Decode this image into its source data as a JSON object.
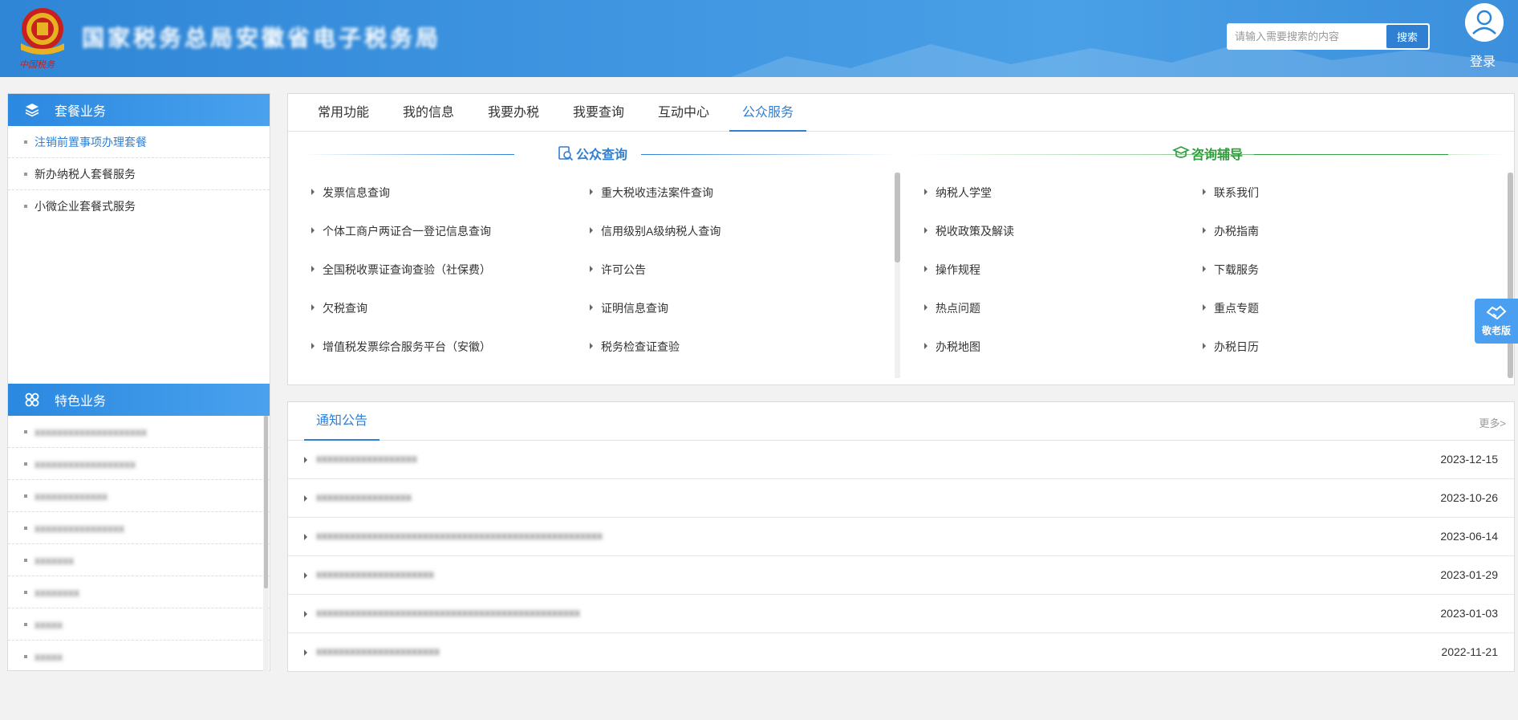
{
  "header": {
    "site_title": "国家税务总局安徽省电子税务局",
    "search_placeholder": "请输入需要搜索的内容",
    "search_button": "搜索",
    "login_label": "登录"
  },
  "sidebar": {
    "package_title": "套餐业务",
    "package_items": [
      {
        "label": "注销前置事项办理套餐",
        "active": true
      },
      {
        "label": "新办纳税人套餐服务",
        "active": false
      },
      {
        "label": "小微企业套餐式服务",
        "active": false
      }
    ],
    "special_title": "特色业务",
    "special_items": [
      {
        "label": "xxxxxxxxxxxxxxxxxxxx"
      },
      {
        "label": "xxxxxxxxxxxxxxxxxx"
      },
      {
        "label": "xxxxxxxxxxxxx"
      },
      {
        "label": "xxxxxxxxxxxxxxxx"
      },
      {
        "label": "xxxxxxx"
      },
      {
        "label": "xxxxxxxx"
      },
      {
        "label": "xxxxx"
      },
      {
        "label": "xxxxx"
      }
    ]
  },
  "tabs": [
    {
      "label": "常用功能",
      "active": false
    },
    {
      "label": "我的信息",
      "active": false
    },
    {
      "label": "我要办税",
      "active": false
    },
    {
      "label": "我要查询",
      "active": false
    },
    {
      "label": "互动中心",
      "active": false
    },
    {
      "label": "公众服务",
      "active": true
    }
  ],
  "public_query": {
    "title": "公众查询",
    "col1": [
      "发票信息查询",
      "个体工商户两证合一登记信息查询",
      "全国税收票证查询查验（社保费）",
      "欠税查询",
      "增值税发票综合服务平台（安徽）"
    ],
    "col2": [
      "重大税收违法案件查询",
      "信用级别A级纳税人查询",
      "许可公告",
      "证明信息查询",
      "税务检查证查验"
    ]
  },
  "consult": {
    "title": "咨询辅导",
    "col1": [
      "纳税人学堂",
      "税收政策及解读",
      "操作规程",
      "热点问题",
      "办税地图"
    ],
    "col2": [
      "联系我们",
      "办税指南",
      "下载服务",
      "重点专题",
      "办税日历"
    ]
  },
  "elder_mode": {
    "label": "敬老版"
  },
  "notices": {
    "tab_label": "通知公告",
    "more_label": "更多>",
    "items": [
      {
        "title": "xxxxxxxxxxxxxxxxxx",
        "date": "2023-12-15"
      },
      {
        "title": "xxxxxxxxxxxxxxxxx",
        "date": "2023-10-26"
      },
      {
        "title": "xxxxxxxxxxxxxxxxxxxxxxxxxxxxxxxxxxxxxxxxxxxxxxxxxxx",
        "date": "2023-06-14"
      },
      {
        "title": "xxxxxxxxxxxxxxxxxxxxx",
        "date": "2023-01-29"
      },
      {
        "title": "xxxxxxxxxxxxxxxxxxxxxxxxxxxxxxxxxxxxxxxxxxxxxxx",
        "date": "2023-01-03"
      },
      {
        "title": "xxxxxxxxxxxxxxxxxxxxxx",
        "date": "2022-11-21"
      }
    ]
  },
  "colors": {
    "primary": "#2f7fd3",
    "header_bg": "#3a90dd",
    "consult_green": "#2e9d3a"
  }
}
